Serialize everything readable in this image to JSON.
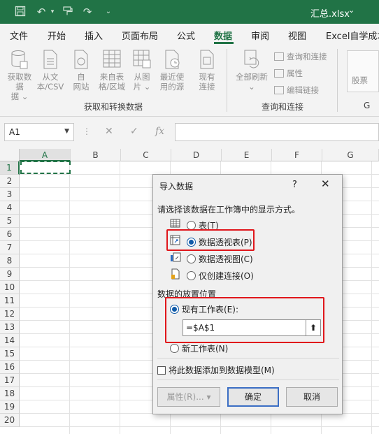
{
  "titlebar": {
    "filename": "汇总.xlsx",
    "icons": [
      "save-icon",
      "undo-icon",
      "undo-dropdown-icon",
      "format-painter-icon",
      "redo-icon",
      "customize-quick-access-icon"
    ],
    "accent": "#217346"
  },
  "tabs": [
    "文件",
    "开始",
    "插入",
    "页面布局",
    "公式",
    "数据",
    "审阅",
    "视图",
    "Excel自学成才"
  ],
  "active_tab": "数据",
  "ribbon": {
    "get_data_label": "获取数据",
    "get_data_label2": "据",
    "from_text_label": "从文",
    "from_text_label2": "本/CSV",
    "from_web_label": "自",
    "from_web_label2": "网站",
    "from_table_label": "来自表",
    "from_table_label2": "格/区域",
    "from_picture_label": "从图",
    "from_picture_label2": "片",
    "recent_sources_label": "最近使",
    "recent_sources_label2": "用的源",
    "existing_conn_label": "现有",
    "existing_conn_label2": "连接",
    "group_get_transform": "获取和转换数据",
    "refresh_all_label": "全部刷新",
    "queries_connections_label": "查询和连接",
    "properties_label": "属性",
    "edit_links_label": "编辑链接",
    "group_queries": "查询和连接",
    "stocks_label": "股票",
    "group_right_fragment": "G"
  },
  "formula_bar": {
    "name_box": "A1",
    "fx_label": "fx",
    "formula": ""
  },
  "grid": {
    "columns": [
      "A",
      "B",
      "C",
      "D",
      "E",
      "F",
      "G"
    ],
    "rows": [
      "1",
      "2",
      "3",
      "4",
      "5",
      "6",
      "7",
      "8",
      "9",
      "10",
      "11",
      "12",
      "13",
      "14",
      "15",
      "16",
      "17",
      "18",
      "19",
      "20"
    ],
    "selected_cell": "A1"
  },
  "dialog": {
    "title": "导入数据",
    "help": "?",
    "close": "✕",
    "prompt": "请选择该数据在工作簿中的显示方式。",
    "options": {
      "table": "表(T)",
      "pivot_table": "数据透视表(P)",
      "pivot_chart": "数据透视图(C)",
      "connection_only": "仅创建连接(O)"
    },
    "selected_option": "数据透视表(P)",
    "placement_heading": "数据的放置位置",
    "existing_sheet": "现有工作表(E):",
    "reference": "=$A$1",
    "new_sheet": "新工作表(N)",
    "data_model_checkbox": "将此数据添加到数据模型(M)",
    "properties_button": "属性(R)...",
    "ok_button": "确定",
    "cancel_button": "取消",
    "highlight_color": "#e0161b"
  }
}
